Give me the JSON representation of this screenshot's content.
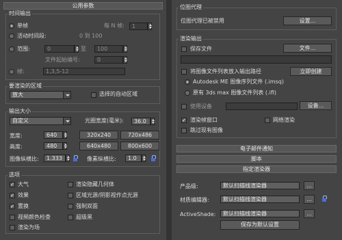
{
  "left": {
    "title": "公用参数",
    "time_output": {
      "label": "时间输出",
      "single": "单帧",
      "every_n_label": "每 N 帧:",
      "every_n_value": "1",
      "active_segment": "活动时间段:",
      "active_range": "0 到 100",
      "range": "范围:",
      "range_from": "0",
      "range_to_label": "至",
      "range_to": "100",
      "file_start_label": "文件起始编号:",
      "file_start_value": "0",
      "frames": "帧:",
      "frames_value": "1,3,5-12"
    },
    "area": {
      "label": "要渲染的区域",
      "selected": "放大",
      "auto_region": "选择的自动区域"
    },
    "output_size": {
      "label": "输出大小",
      "preset": "自定义",
      "aperture_label": "光圈宽度(毫米):",
      "aperture_value": "36.0",
      "width_label": "宽度:",
      "width_value": "640",
      "height_label": "高度:",
      "height_value": "480",
      "presets": [
        "320x240",
        "720x486",
        "640x480",
        "800x600"
      ],
      "image_aspect_label": "图像纵横比:",
      "image_aspect_value": "1.333",
      "pixel_aspect_label": "像素纵横比:",
      "pixel_aspect_value": "1.0"
    },
    "options": {
      "label": "选项",
      "col1": [
        "大气",
        "效果",
        "置换",
        "视频颜色检查",
        "渲染为场"
      ],
      "col1_checked": [
        true,
        true,
        true,
        false,
        false
      ],
      "col2": [
        "渲染隐藏几何体",
        "区域光源/阴影视作点光源",
        "强制双面",
        "超级黑"
      ],
      "col2_checked": [
        false,
        false,
        false,
        false
      ]
    }
  },
  "right": {
    "proxy": {
      "label": "位图代理",
      "status": "位图代理已被禁用",
      "setup_button": "设置..."
    },
    "render_output": {
      "label": "渲染输出",
      "save_file": "保存文件",
      "files_button": "文件...",
      "put_in_sequence": "将图像文件列表放入输出路径",
      "create_now": "立即创建",
      "option_imsq": "Autodesk ME 图像序列文件 (.imsq)",
      "option_ifl": "原有 3ds max 图像文件列表 (.ifl)",
      "use_device": "使用设备",
      "devices_button": "设备...",
      "render_frame_window": "渲染帧窗口",
      "net_render": "网络渲染",
      "skip_existing": "跳过现有图像"
    },
    "rollouts": [
      "电子邮件通知",
      "脚本",
      "指定渲染器"
    ],
    "assign": {
      "production_label": "产品级:",
      "production_value": "默认扫描线渲染器",
      "material_label": "材质编辑器:",
      "material_value": "默认扫描线渲染器",
      "activeshade_label": "ActiveShade:",
      "activeshade_value": "默认扫描线渲染器",
      "more_button": "...",
      "save_default": "保存为默认设置"
    }
  }
}
